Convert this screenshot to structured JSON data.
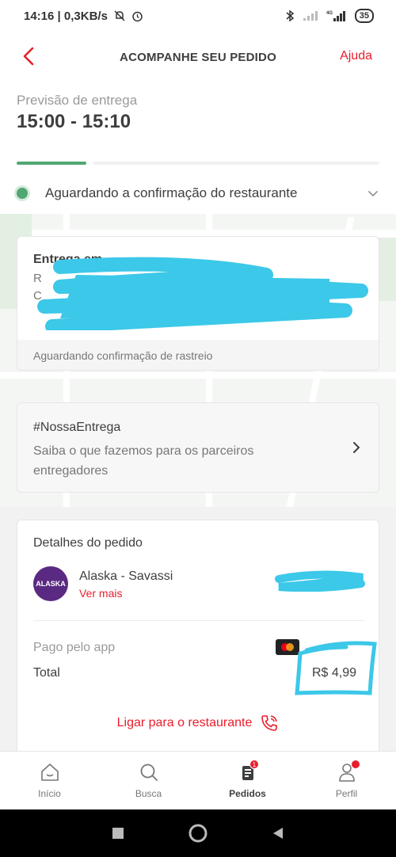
{
  "statusbar": {
    "time_speed": "14:16 | 0,3KB/s",
    "network": "4G",
    "battery": "35"
  },
  "header": {
    "title": "ACOMPANHE SEU PEDIDO",
    "help": "Ajuda"
  },
  "forecast": {
    "label": "Previsão de entrega",
    "time": "15:00 - 15:10"
  },
  "progress": {
    "done_fraction": 0.2
  },
  "status": {
    "text": "Aguardando a confirmação do restaurante"
  },
  "address_card": {
    "title": "Entrega em",
    "footer": "Aguardando confirmação de rastreio"
  },
  "entrega_card": {
    "title": "#NossaEntrega",
    "description": "Saiba o que fazemos para os parceiros entregadores"
  },
  "details": {
    "title": "Detalhes do pedido",
    "store_logo_text": "ALASKA",
    "store_name": "Alaska - Savassi",
    "see_more": "Ver mais",
    "paid_label": "Pago pelo app",
    "total_label": "Total",
    "total_value": "R$ 4,99",
    "call_label": "Ligar para o restaurante"
  },
  "bottomnav": [
    {
      "label": "Início",
      "icon": "home-icon"
    },
    {
      "label": "Busca",
      "icon": "search-icon"
    },
    {
      "label": "Pedidos",
      "icon": "orders-icon",
      "badge": "1"
    },
    {
      "label": "Perfil",
      "icon": "profile-icon"
    }
  ],
  "colors": {
    "accent": "#ea1d2c",
    "success": "#50a773",
    "scribble": "#3cc8e8"
  }
}
